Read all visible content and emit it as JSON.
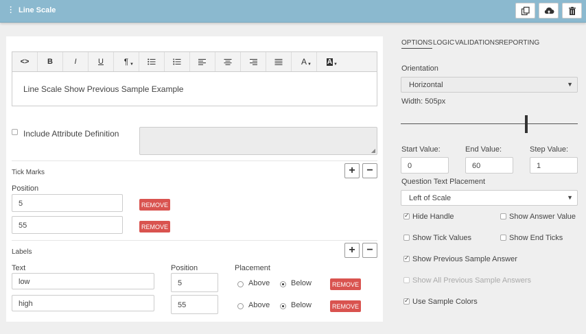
{
  "header": {
    "title": "Line Scale"
  },
  "editor": {
    "tools": [
      "<>",
      "B",
      "I",
      "U",
      "¶",
      "list-ul",
      "list-ol",
      "align-left",
      "align-center",
      "align-right",
      "align-justify",
      "A",
      "A"
    ],
    "content": "Line Scale Show Previous Sample Example"
  },
  "include_attr": {
    "label": "Include Attribute Definition",
    "checked": false
  },
  "tick_marks": {
    "heading": "Tick Marks",
    "position_label": "Position",
    "rows": [
      {
        "value": "5",
        "remove": "REMOVE"
      },
      {
        "value": "55",
        "remove": "REMOVE"
      }
    ]
  },
  "labels": {
    "heading": "Labels",
    "col_text": "Text",
    "col_position": "Position",
    "col_placement": "Placement",
    "above": "Above",
    "below": "Below",
    "rows": [
      {
        "text": "low",
        "position": "5",
        "placement": "below",
        "remove": "REMOVE"
      },
      {
        "text": "high",
        "position": "55",
        "placement": "below",
        "remove": "REMOVE"
      }
    ]
  },
  "right_panel": {
    "tabs": [
      "OPTIONS",
      "LOGIC",
      "VALIDATIONS",
      "REPORTING"
    ],
    "active_tab": "OPTIONS",
    "orientation_label": "Orientation",
    "orientation_value": "Horizontal",
    "width_label": "Width: 505px",
    "slider_value": 0.71,
    "start_label": "Start Value:",
    "start_value": "0",
    "end_label": "End Value:",
    "end_value": "60",
    "step_label": "Step Value:",
    "step_value": "1",
    "qtp_label": "Question Text Placement",
    "qtp_value": "Left of Scale",
    "options": {
      "hide_handle": {
        "label": "Hide Handle",
        "checked": true
      },
      "show_answer_value": {
        "label": "Show Answer Value",
        "checked": false
      },
      "show_tick_values": {
        "label": "Show Tick Values",
        "checked": false
      },
      "show_end_ticks": {
        "label": "Show End Ticks",
        "checked": false
      },
      "show_prev_sample": {
        "label": "Show Previous Sample Answer",
        "checked": true
      },
      "show_all_prev": {
        "label": "Show All Previous Sample Answers",
        "checked": false,
        "disabled": true
      },
      "use_sample_colors": {
        "label": "Use Sample Colors",
        "checked": true
      }
    }
  },
  "colors": {
    "header": "#8bb9cf",
    "remove": "#d9534f"
  }
}
